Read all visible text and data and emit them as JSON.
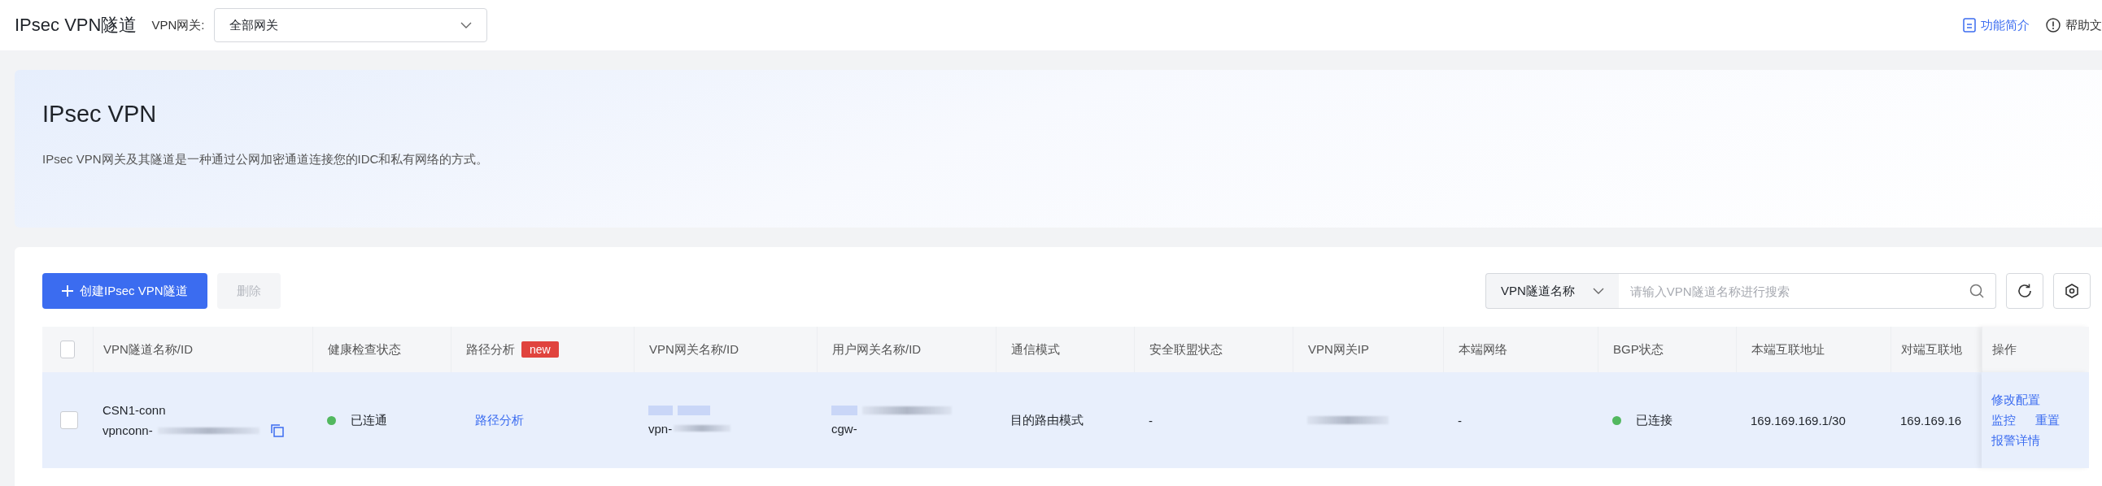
{
  "header": {
    "title": "IPsec VPN隧道",
    "gateway_select": {
      "label": "VPN网关:",
      "value": "全部网关"
    },
    "links": [
      {
        "label": "功能简介",
        "kind": "doc"
      },
      {
        "label": "帮助文",
        "kind": "help"
      }
    ]
  },
  "intro": {
    "title": "IPsec VPN",
    "description": "IPsec VPN网关及其隧道是一种通过公网加密通道连接您的IDC和私有网络的方式。"
  },
  "toolbar": {
    "buttons": [
      {
        "label": "创建IPsec VPN隧道",
        "kind": "primary",
        "disabled": false
      },
      {
        "label": "删除",
        "kind": "default",
        "disabled": true
      }
    ],
    "search": {
      "filter": "VPN隧道名称",
      "placeholder": "请输入VPN隧道名称进行搜索"
    }
  },
  "table": {
    "select_all": {
      "checked": false
    },
    "columns": [
      {
        "label": "VPN隧道名称/ID"
      },
      {
        "label": "健康检查状态"
      },
      {
        "label": "路径分析",
        "badge": "new"
      },
      {
        "label": "VPN网关名称/ID"
      },
      {
        "label": "用户网关名称/ID"
      },
      {
        "label": "通信模式"
      },
      {
        "label": "安全联盟状态"
      },
      {
        "label": "VPN网关IP"
      },
      {
        "label": "本端网络"
      },
      {
        "label": "BGP状态"
      },
      {
        "label": "本端互联地址"
      },
      {
        "label": "对端互联地"
      },
      {
        "label": "操作"
      }
    ],
    "rows": [
      {
        "checked": false,
        "name": "CSN1-conn",
        "id": "vpnconn-",
        "health": {
          "label": "已连通",
          "color": "#52b85f"
        },
        "path": "路径分析",
        "vpn_gateway_id": "vpn-",
        "user_gateway_id": "cgw-",
        "mode": "目的路由模式",
        "sa_state": "-",
        "local_network": "-",
        "bgp": {
          "label": "已连接",
          "color": "#52b85f"
        },
        "local_address": "169.169.169.1/30",
        "remote_address": "169.169.16",
        "actions": [
          "修改配置",
          "监控",
          "重置",
          "报警详情"
        ]
      }
    ]
  }
}
